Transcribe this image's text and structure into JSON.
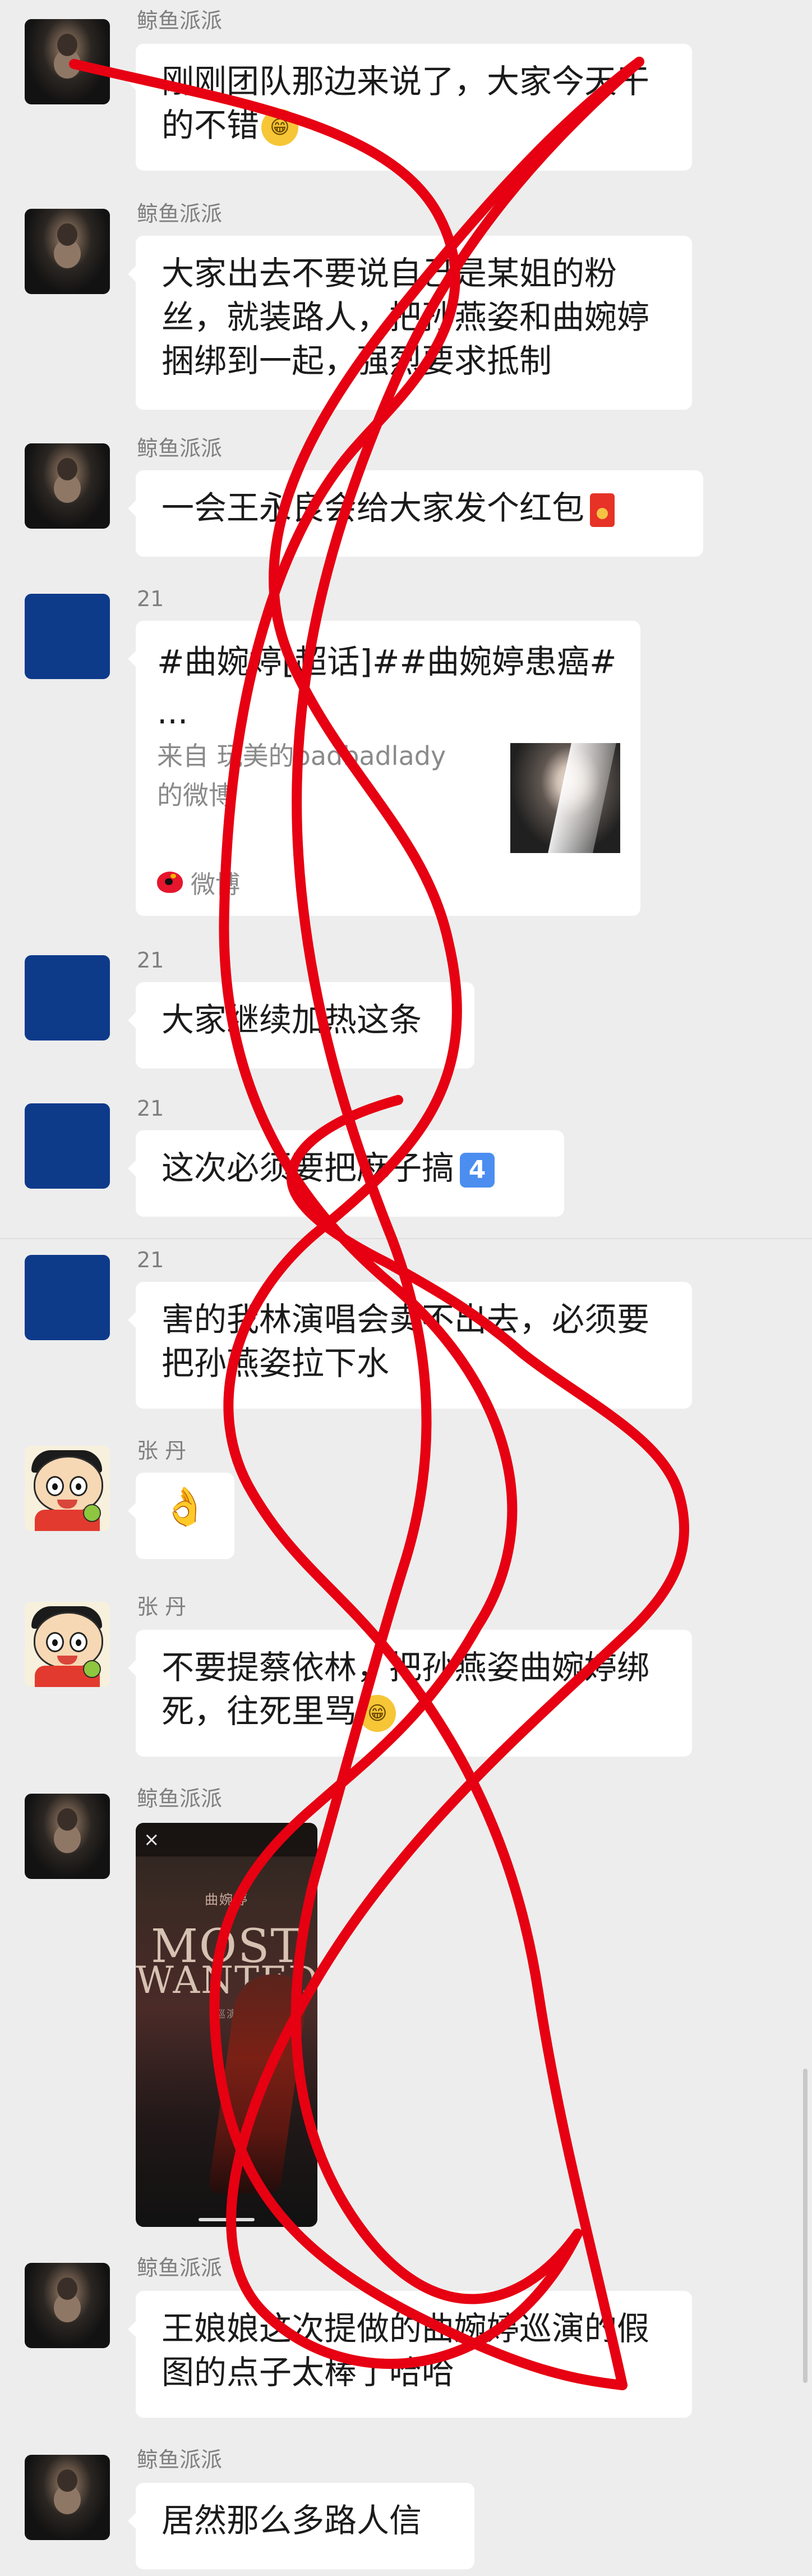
{
  "messages": [
    {
      "sender": "鲸鱼派派",
      "text": "刚刚团队那边来说了，大家今天干的不错",
      "emoji": "grinning-face"
    },
    {
      "sender": "鲸鱼派派",
      "text": "大家出去不要说自己是某姐的粉丝，就装路人，把孙燕姿和曲婉婷捆绑到一起，强烈要求抵制"
    },
    {
      "sender": "鲸鱼派派",
      "text": "一会王永良会给大家发个红包",
      "emoji": "red-envelope"
    },
    {
      "sender": "21",
      "card": {
        "title": "#曲婉婷[超话]##曲婉婷患癌# ...",
        "source": "来自 玩美的badbadlady的微博",
        "footer": "微博"
      }
    },
    {
      "sender": "21",
      "text": "大家继续加热这条"
    },
    {
      "sender": "21",
      "text": "这次必须要把麻子搞",
      "badge": "4"
    },
    {
      "sender": "21",
      "text": "害的我林演唱会卖不出去，必须要把孙燕姿拉下水"
    },
    {
      "sender": "张 丹",
      "emoji": "ok-hand"
    },
    {
      "sender": "张 丹",
      "text": "不要提蔡依林，把孙燕姿曲婉婷绑死，往死里骂",
      "emoji": "grinning-face"
    },
    {
      "sender": "鲸鱼派派",
      "image": {
        "subtitle": "曲婉婷",
        "title_line1": "MOST",
        "title_line2": "WANTED",
        "small_text": "巡演"
      }
    },
    {
      "sender": "鲸鱼派派",
      "text": "王娘娘这次提做的曲婉婷巡演的假图的点子太棒了哈哈"
    },
    {
      "sender": "鲸鱼派派",
      "text": "居然那么多路人信"
    }
  ],
  "icons": {
    "grin": "grinning-face",
    "red_envelope": "red-envelope",
    "keycap": "keycap-4",
    "ok": "ok-hand",
    "weibo": "weibo-logo",
    "close": "close-icon"
  },
  "colors": {
    "background": "#ededed",
    "bubble": "#ffffff",
    "sender": "#7f7f7f",
    "scribble": "#e60012",
    "weibo": "#e6162d"
  },
  "glyphs": {
    "grin": "😁",
    "ok": "👌",
    "close": "×"
  }
}
